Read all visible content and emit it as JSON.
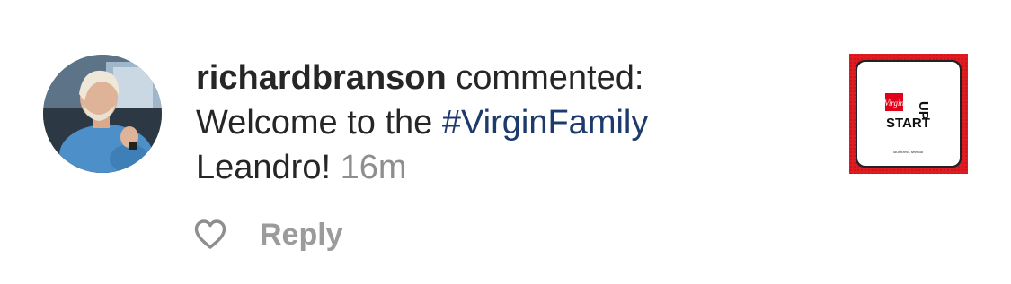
{
  "comment": {
    "username": "richardbranson",
    "action": "commented:",
    "text_before": "Welcome to the",
    "hashtag": "#VirginFamily",
    "text_after": "Leandro!",
    "timestamp": "16m"
  },
  "actions": {
    "like_icon": "heart-outline-icon",
    "reply_label": "Reply"
  },
  "post_thumbnail": {
    "logo_word": "Virgin",
    "start_label": "START",
    "up_label": "UP",
    "subtitle": "Business Mentor"
  },
  "colors": {
    "text": "#262626",
    "hashtag": "#1c3a6c",
    "muted": "#8e8e8e",
    "reply": "#9b9b9b",
    "virgin_red": "#e1001a"
  }
}
